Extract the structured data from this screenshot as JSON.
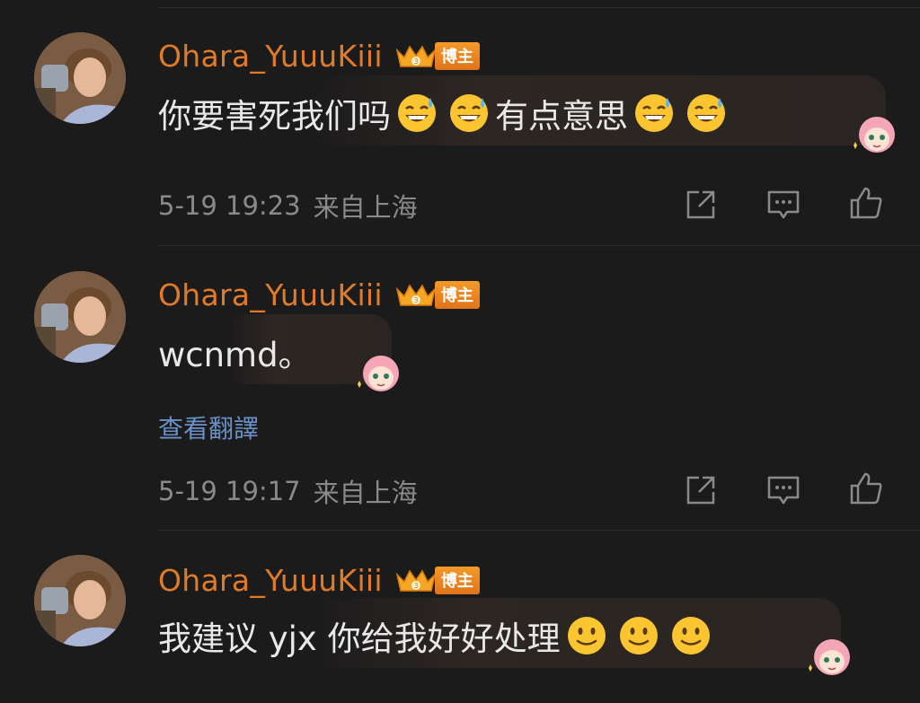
{
  "comments": [
    {
      "username": "Ohara_YuuuKiii",
      "badge_label": "博主",
      "text_parts": [
        "你要害死我们吗",
        "有点意思"
      ],
      "emoji_type": "sweat-smile-emoji",
      "time": "5-19 19:23",
      "location": "来自上海"
    },
    {
      "username": "Ohara_YuuuKiii",
      "badge_label": "博主",
      "text": "wcnmd。",
      "translate_label": "查看翻譯",
      "time": "5-19 19:17",
      "location": "来自上海"
    },
    {
      "username": "Ohara_YuuuKiii",
      "badge_label": "博主",
      "text": "我建议 yjx 你给我好好处理",
      "emoji_type": "slight-smile-emoji"
    }
  ],
  "colors": {
    "background": "#1b1b1b",
    "username": "#e07b2a",
    "body_text": "#e8e8e8",
    "meta_text": "#8a8a8a",
    "link": "#6b90c9",
    "badge": "#f08c25"
  },
  "icons": {
    "share": "share-icon",
    "comment": "comment-icon",
    "like": "thumbs-up-icon"
  }
}
